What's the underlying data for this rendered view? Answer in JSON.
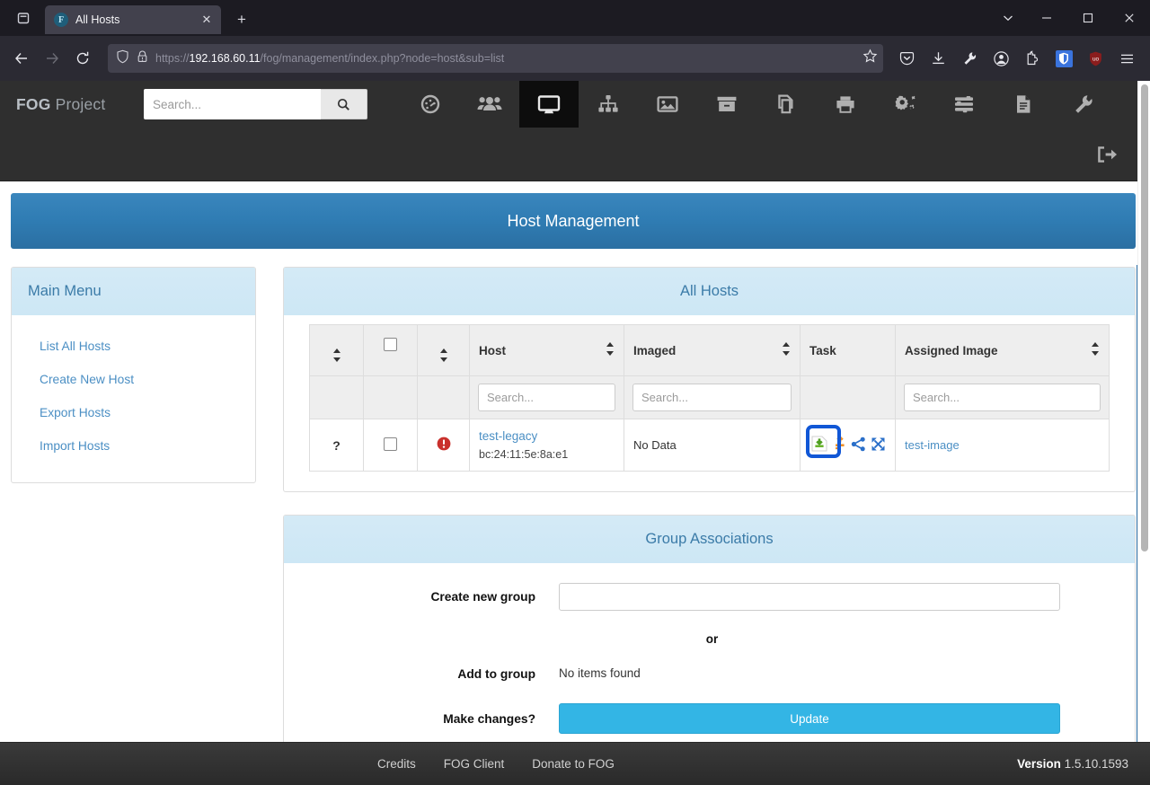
{
  "browser": {
    "tab": {
      "title": "All Hosts",
      "favicon_letter": "F",
      "favicon_name": "fog-favicon"
    },
    "newtab_label": "+",
    "close_label": "✕",
    "window_controls": {
      "list_all_tabs": "⌄",
      "minimize": "─",
      "maximize": "□",
      "close": "✕"
    },
    "url": {
      "prefix": "https://",
      "host": "192.168.60.11",
      "path": "/fog/management/index.php?node=host&sub=list",
      "full": "https://192.168.60.11/fog/management/index.php?node=host&sub=list"
    },
    "icons": {
      "back": "back-arrow-icon",
      "forward": "forward-arrow-icon",
      "reload": "reload-icon",
      "shield": "tracking-protection-shield-icon",
      "lock_warning": "insecure-lock-warning-icon",
      "bookmark": "bookmark-star-icon",
      "pocket": "pocket-icon",
      "downloads": "downloads-icon",
      "wrench": "devtools-wrench-icon",
      "account": "account-circle-icon",
      "extensions": "extensions-puzzle-icon",
      "bitwarden": "bitwarden-shield-icon",
      "ublock": "ublock-origin-icon",
      "menu": "hamburger-menu-icon"
    }
  },
  "fog": {
    "brand": {
      "bold": "FOG",
      "light": "Project"
    },
    "search": {
      "value": "",
      "placeholder": "Search..."
    },
    "nav": [
      {
        "name": "dashboard",
        "icon": "dashboard-gauge-icon",
        "active": false
      },
      {
        "name": "user-management",
        "icon": "users-group-icon",
        "active": false
      },
      {
        "name": "host-management",
        "icon": "desktop-monitor-icon",
        "active": true
      },
      {
        "name": "group-management",
        "icon": "sitemap-icon",
        "active": false
      },
      {
        "name": "image-management",
        "icon": "picture-image-icon",
        "active": false
      },
      {
        "name": "storage-management",
        "icon": "archive-box-icon",
        "active": false
      },
      {
        "name": "snapin-management",
        "icon": "clone-copies-icon",
        "active": false
      },
      {
        "name": "printer-management",
        "icon": "printer-icon",
        "active": false
      },
      {
        "name": "service-configuration",
        "icon": "gears-cogs-icon",
        "active": false
      },
      {
        "name": "task-management",
        "icon": "tasks-sliders-icon",
        "active": false
      },
      {
        "name": "report-management",
        "icon": "report-document-icon",
        "active": false
      },
      {
        "name": "fog-configuration",
        "icon": "wrench-icon",
        "active": false
      }
    ],
    "logout_icon": "sign-out-icon",
    "page_title": "Host Management",
    "sidebar": {
      "title": "Main Menu",
      "items": [
        {
          "label": "List All Hosts"
        },
        {
          "label": "Create New Host"
        },
        {
          "label": "Export Hosts"
        },
        {
          "label": "Import Hosts"
        }
      ]
    },
    "hosts_panel": {
      "title": "All Hosts",
      "columns": [
        {
          "label": "",
          "name": "status",
          "sortable": true,
          "filter": false
        },
        {
          "label": "",
          "name": "select-all",
          "sortable": false,
          "filter": false,
          "checkbox": true
        },
        {
          "label": "",
          "name": "alert",
          "sortable": true,
          "filter": false
        },
        {
          "label": "Host",
          "name": "host",
          "sortable": true,
          "filter": true
        },
        {
          "label": "Imaged",
          "name": "imaged",
          "sortable": true,
          "filter": true
        },
        {
          "label": "Task",
          "name": "task",
          "sortable": false,
          "filter": false
        },
        {
          "label": "Assigned Image",
          "name": "assigned-image",
          "sortable": true,
          "filter": true
        }
      ],
      "filter_placeholder": "Search...",
      "rows": [
        {
          "status": "?",
          "checked": false,
          "alert_icon": "red-exclamation-circle-icon",
          "host": "test-legacy",
          "mac": "bc:24:11:5e:8a:e1",
          "imaged": "No Data",
          "task_icons": [
            {
              "name": "deploy-download-icon",
              "color": "#5aa02c"
            },
            {
              "name": "capture-upload-icon",
              "color": "#f0932b"
            },
            {
              "name": "multicast-share-icon",
              "color": "#2a6fc9"
            },
            {
              "name": "advanced-arrows-icon",
              "color": "#2a6fc9"
            }
          ],
          "assigned_image": "test-image",
          "annotation": "blue-hand-drawn-circle"
        }
      ]
    },
    "group_associations": {
      "title": "Group Associations",
      "create_label": "Create new group",
      "create_value": "",
      "or_label": "or",
      "add_label": "Add to group",
      "add_value": "No items found",
      "changes_label": "Make changes?",
      "update_button": "Update"
    },
    "footer": {
      "links": [
        "Credits",
        "FOG Client",
        "Donate to FOG"
      ],
      "version_label": "Version",
      "version_number": "1.5.10.1593"
    },
    "colors": {
      "page_header_blue": "#2f7cb3",
      "panel_header_blue": "#cde7f5",
      "link_blue": "#4b8fc4",
      "update_button": "#33b5e5",
      "annotation": "#1157d6",
      "alert_red": "#c9302c"
    }
  }
}
